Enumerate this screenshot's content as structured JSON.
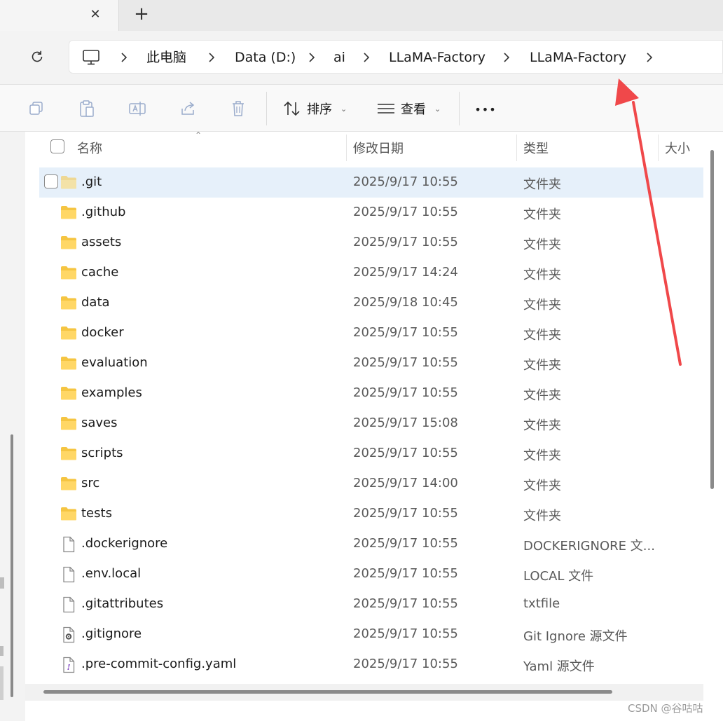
{
  "tabs": {
    "close_glyph": "✕",
    "new_glyph": "+"
  },
  "breadcrumb": {
    "items": [
      "此电脑",
      "Data (D:)",
      "ai",
      "LLaMA-Factory",
      "LLaMA-Factory"
    ]
  },
  "toolbar": {
    "sort_label": "排序",
    "view_label": "查看",
    "more_label": "•••"
  },
  "columns": {
    "name": "名称",
    "date": "修改日期",
    "type": "类型",
    "size": "大小"
  },
  "files": [
    {
      "name": ".git",
      "date": "2025/9/17 10:55",
      "type": "文件夹",
      "icon": "folder-icon"
    },
    {
      "name": ".github",
      "date": "2025/9/17 10:55",
      "type": "文件夹",
      "icon": "folder-icon"
    },
    {
      "name": "assets",
      "date": "2025/9/17 10:55",
      "type": "文件夹",
      "icon": "folder-icon"
    },
    {
      "name": "cache",
      "date": "2025/9/17 14:24",
      "type": "文件夹",
      "icon": "folder-icon"
    },
    {
      "name": "data",
      "date": "2025/9/18 10:45",
      "type": "文件夹",
      "icon": "folder-icon"
    },
    {
      "name": "docker",
      "date": "2025/9/17 10:55",
      "type": "文件夹",
      "icon": "folder-icon"
    },
    {
      "name": "evaluation",
      "date": "2025/9/17 10:55",
      "type": "文件夹",
      "icon": "folder-icon"
    },
    {
      "name": "examples",
      "date": "2025/9/17 10:55",
      "type": "文件夹",
      "icon": "folder-icon"
    },
    {
      "name": "saves",
      "date": "2025/9/17 15:08",
      "type": "文件夹",
      "icon": "folder-icon"
    },
    {
      "name": "scripts",
      "date": "2025/9/17 10:55",
      "type": "文件夹",
      "icon": "folder-icon"
    },
    {
      "name": "src",
      "date": "2025/9/17 14:00",
      "type": "文件夹",
      "icon": "folder-icon"
    },
    {
      "name": "tests",
      "date": "2025/9/17 10:55",
      "type": "文件夹",
      "icon": "folder-icon"
    },
    {
      "name": ".dockerignore",
      "date": "2025/9/17 10:55",
      "type": "DOCKERIGNORE 文...",
      "icon": "file-icon"
    },
    {
      "name": ".env.local",
      "date": "2025/9/17 10:55",
      "type": "LOCAL 文件",
      "icon": "file-icon"
    },
    {
      "name": ".gitattributes",
      "date": "2025/9/17 10:55",
      "type": "txtfile",
      "icon": "file-icon"
    },
    {
      "name": ".gitignore",
      "date": "2025/9/17 10:55",
      "type": "Git Ignore 源文件",
      "icon": "gear-file-icon"
    },
    {
      "name": ".pre-commit-config.yaml",
      "date": "2025/9/17 10:55",
      "type": "Yaml 源文件",
      "icon": "yaml-file-icon"
    }
  ],
  "selected_index": 0,
  "watermark": "CSDN @谷咕咕",
  "colors": {
    "folder": "#f5c542",
    "selection": "#e6f0fa",
    "arrow": "#f0484a"
  }
}
